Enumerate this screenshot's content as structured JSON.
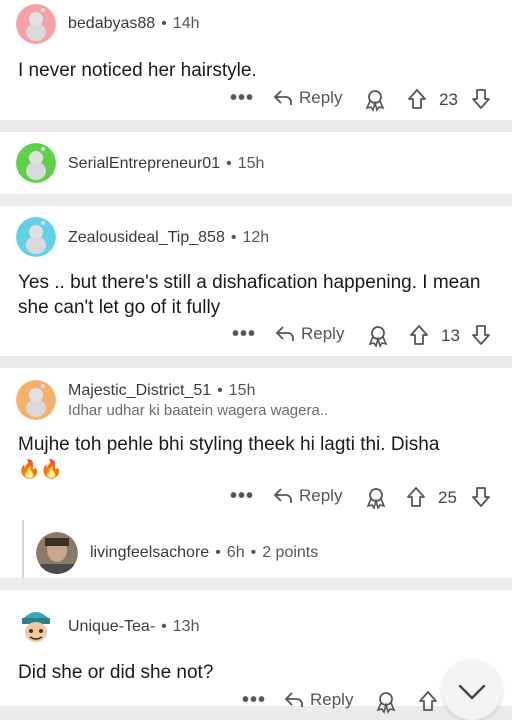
{
  "comments": [
    {
      "user": "bedabyas88",
      "time": "14h",
      "text": "I never noticed her hairstyle.",
      "reply_label": "Reply",
      "score": "23",
      "avatar_color": "#f6a0a8"
    },
    {
      "user": "SerialEntrepreneur01",
      "time": "15h",
      "avatar_color": "#5fd04a"
    },
    {
      "user": "Zealousideal_Tip_858",
      "time": "12h",
      "text": "Yes .. but there's still a dishafication happening. I mean she can't let go of it fully",
      "reply_label": "Reply",
      "score": "13",
      "avatar_color": "#63d0e8"
    },
    {
      "user": "Majestic_District_51",
      "time": "15h",
      "flair": "Idhar udhar ki baatein wagera wagera..",
      "text": "Mujhe toh pehle bhi styling theek hi lagti thi. Disha",
      "emoji": "🔥🔥",
      "reply_label": "Reply",
      "score": "25",
      "avatar_color": "#f5b16a"
    },
    {
      "user": "livingfeelsachore",
      "time": "6h",
      "points": "2 points"
    },
    {
      "user": "Unique-Tea-",
      "time": "13h",
      "text": "Did she or did she not?",
      "reply_label": "Reply"
    }
  ],
  "more_label": "•••"
}
